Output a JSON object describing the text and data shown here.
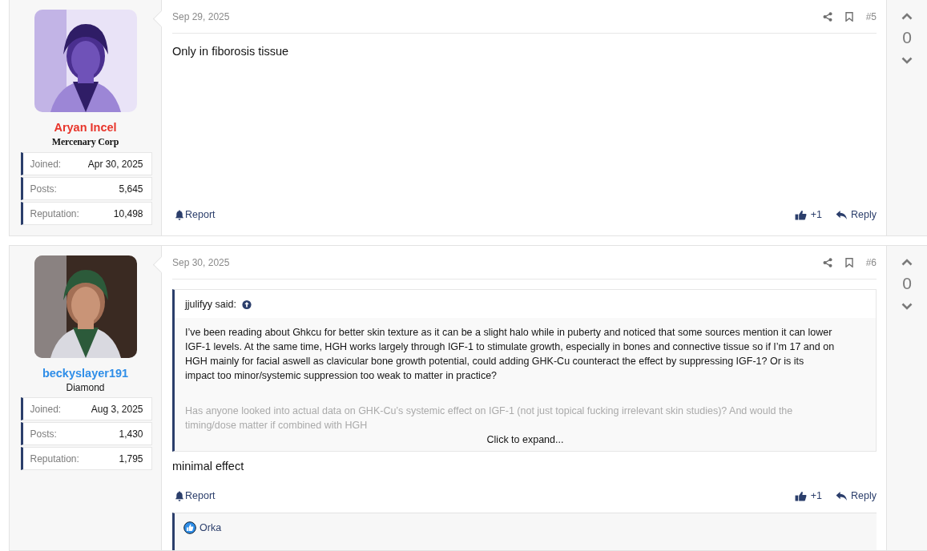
{
  "posts": [
    {
      "author": {
        "name": "Aryan Incel",
        "color": "#e8352b",
        "title": "Mercenary Corp",
        "kind": "gothic"
      },
      "stats": [
        {
          "label": "Joined:",
          "value": "Apr 30, 2025"
        },
        {
          "label": "Posts:",
          "value": "5,645"
        },
        {
          "label": "Reputation:",
          "value": "10,498"
        }
      ],
      "date": "Sep 29, 2025",
      "number": "#5",
      "body": "Only in fiborosis tissue",
      "footer": {
        "report": "Report",
        "likes": "+1",
        "reply": "Reply"
      },
      "score": "0"
    },
    {
      "author": {
        "name": "beckyslayer191",
        "color": "#2f8ee8",
        "title": "Diamond",
        "kind": "plain"
      },
      "stats": [
        {
          "label": "Joined:",
          "value": "Aug 3, 2025"
        },
        {
          "label": "Posts:",
          "value": "1,430"
        },
        {
          "label": "Reputation:",
          "value": "1,795"
        }
      ],
      "date": "Sep 30, 2025",
      "number": "#6",
      "quote": {
        "author": "jjulifyy said:",
        "paragraphs": [
          "I’ve been reading about Ghkcu for better skin texture as it can be a slight halo while in puberty and noticed that some sources mention it can lower IGF-1 levels. At the same time, HGH works largely through IGF-1 to stimulate growth, especially in bones and connective tissue so if I’m 17 and on HGH mainly for facial aswell as clavicular bone growth potential, could adding GHK-Cu counteract the effect by suppressing IGF-1? Or is its impact too minor/systemic suppression too weak to matter in practice?",
          "Has anyone looked into actual data on GHK-Cu’s systemic effect on IGF-1 (not just topical fucking irrelevant skin studies)? And would the timing/dose matter if combined with HGH"
        ],
        "expand": "Click to expand..."
      },
      "body": "minimal effect",
      "footer": {
        "report": "Report",
        "likes": "+1",
        "reply": "Reply"
      },
      "reactions": [
        "Orka"
      ],
      "score": "0"
    }
  ]
}
